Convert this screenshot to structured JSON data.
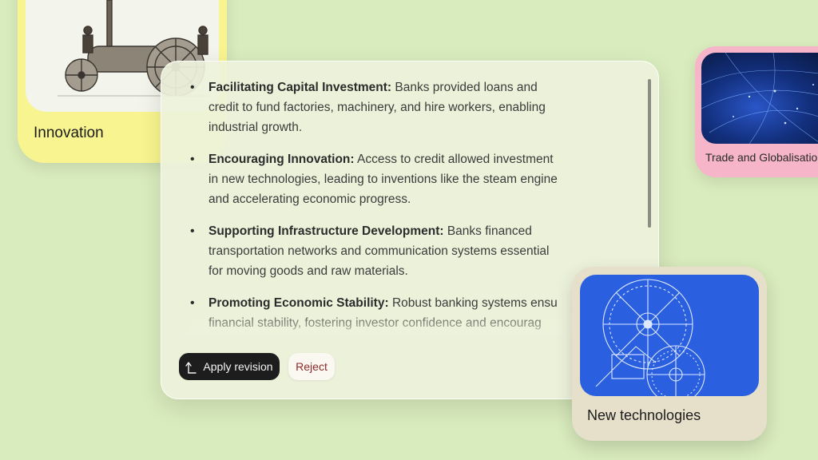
{
  "cards": {
    "innovation": {
      "label": "Innovation",
      "image": "steam-engine-engraving"
    },
    "trade": {
      "label": "Trade and Globalisation",
      "image": "earth-night-network"
    },
    "tech": {
      "label": "New technologies",
      "image": "gear-blueprint"
    }
  },
  "revision": {
    "items": [
      {
        "title": "Facilitating Capital Investment:",
        "lines": [
          "Banks provided loans and",
          "credit to fund factories, machinery, and hire workers, enabling",
          "industrial growth."
        ]
      },
      {
        "title": "Encouraging Innovation:",
        "lines": [
          "Access to credit allowed investment",
          "in new technologies, leading to inventions like the steam engine",
          "and accelerating economic progress."
        ]
      },
      {
        "title": "Supporting Infrastructure Development:",
        "lines": [
          "Banks financed",
          "transportation networks and communication systems essential",
          "for moving goods and raw materials."
        ]
      },
      {
        "title": "Promoting Economic Stability:",
        "lines": [
          "Robust banking systems ensu",
          "financial stability, fostering investor confidence and encourag"
        ]
      }
    ],
    "apply_label": "Apply revision",
    "reject_label": "Reject"
  },
  "colors": {
    "background": "#d9ecbd",
    "innovation_card": "#f8f48f",
    "trade_card": "#f6b5c9",
    "tech_card": "#e6e0cb",
    "blueprint": "#2a5fe0",
    "apply_button": "#1d1d1d",
    "reject_text": "#8a2a2a"
  }
}
